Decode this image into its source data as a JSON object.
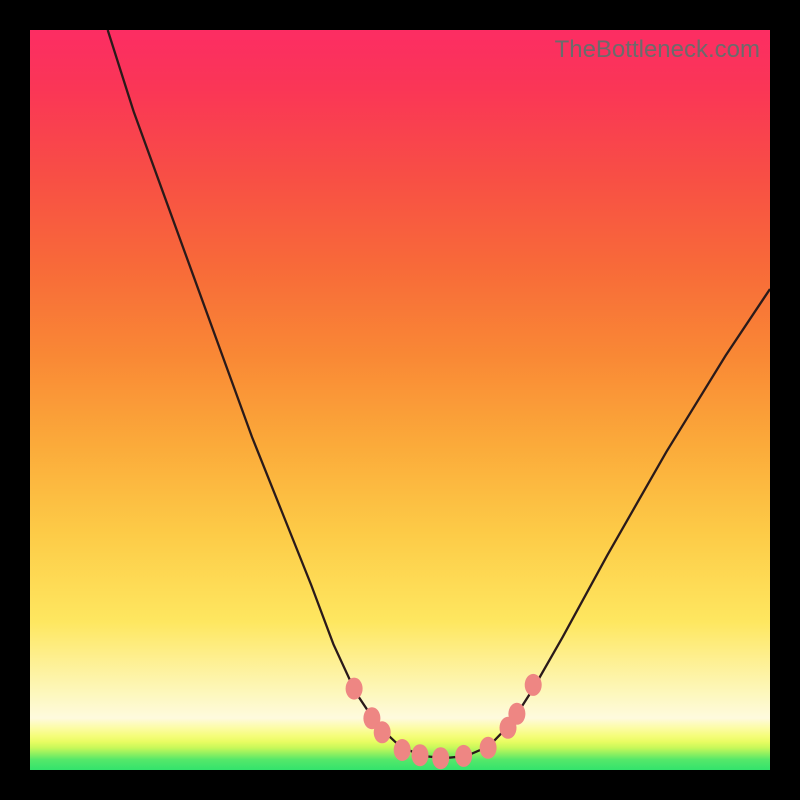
{
  "watermark": "TheBottleneck.com",
  "colors": {
    "bead": "#ee8683",
    "curve": "#2a1a1a",
    "frame": "#000000"
  },
  "chart_data": {
    "type": "line",
    "title": "",
    "xlabel": "",
    "ylabel": "",
    "xlim": [
      0,
      100
    ],
    "ylim": [
      0,
      100
    ],
    "grid": false,
    "legend": false,
    "series": [
      {
        "name": "curve",
        "x": [
          10.5,
          14,
          18,
          22,
          26,
          30,
          34,
          38,
          41,
          44,
          47,
          50,
          53,
          56,
          59,
          62,
          65,
          68,
          72,
          78,
          86,
          94,
          100
        ],
        "y": [
          100,
          89,
          78,
          67,
          56,
          45,
          35,
          25,
          17,
          10.5,
          6,
          3.2,
          1.9,
          1.6,
          1.9,
          3.2,
          6.3,
          11,
          18,
          29,
          43,
          56,
          65
        ]
      }
    ],
    "markers": [
      {
        "name": "left-bead-1",
        "x": 43.8,
        "y": 11.0
      },
      {
        "name": "left-bead-2",
        "x": 46.2,
        "y": 7.0
      },
      {
        "name": "left-bead-3",
        "x": 47.6,
        "y": 5.1
      },
      {
        "name": "flat-bead-1",
        "x": 50.3,
        "y": 2.7
      },
      {
        "name": "flat-bead-2",
        "x": 52.7,
        "y": 2.0
      },
      {
        "name": "flat-bead-3",
        "x": 55.5,
        "y": 1.6
      },
      {
        "name": "flat-bead-4",
        "x": 58.6,
        "y": 1.9
      },
      {
        "name": "flat-bead-5",
        "x": 61.9,
        "y": 3.0
      },
      {
        "name": "right-bead-1",
        "x": 64.6,
        "y": 5.7
      },
      {
        "name": "right-bead-2",
        "x": 65.8,
        "y": 7.6
      },
      {
        "name": "right-bead-3",
        "x": 68.0,
        "y": 11.5
      }
    ]
  }
}
